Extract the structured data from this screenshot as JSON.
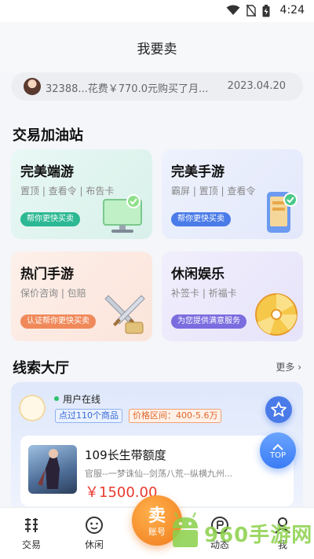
{
  "status_bar": {
    "time": "4:24"
  },
  "header": {
    "title": "我要卖"
  },
  "ticker": {
    "message": "32388...花费￥770.0元购买了月...",
    "date": "2023.04.20"
  },
  "boost_station": {
    "title": "交易加油站",
    "cards": [
      {
        "title": "完美端游",
        "subtitle": "置顶 | 查看令 | 布告卡",
        "button": "帮你更快买卖"
      },
      {
        "title": "完美手游",
        "subtitle": "霸屏 | 置顶 | 查看令",
        "button": "帮你更快买卖"
      },
      {
        "title": "热门手游",
        "subtitle": "保价咨询 | 包赔",
        "button": "认证帮你更快买卖"
      },
      {
        "title": "休闲娱乐",
        "subtitle": "补签卡 | 祈福卡",
        "button": "为您提供满意服务"
      }
    ]
  },
  "leads": {
    "title": "线索大厅",
    "more": "更多",
    "online_text": "用户在线",
    "goods_tag": "点过110个商品",
    "price_tag": "价格区间：400-5.6万",
    "product": {
      "title": "109长生带额度",
      "desc": "官服--一梦诛仙--剑荡八荒--纵横九州...",
      "price": "￥1500.00"
    }
  },
  "top_button": "TOP",
  "tabbar": {
    "items": [
      {
        "label": "交易"
      },
      {
        "label": "休闲"
      },
      {
        "label": "动态"
      },
      {
        "label": "我"
      }
    ],
    "sell_main": "卖",
    "sell_sub": "账号"
  },
  "watermark": {
    "text": "960手游网"
  },
  "colors": {
    "green": "#2bb893",
    "blue": "#4a7be8",
    "orange": "#f0895a",
    "purple": "#7b6cdf",
    "price_red": "#e8392f"
  }
}
